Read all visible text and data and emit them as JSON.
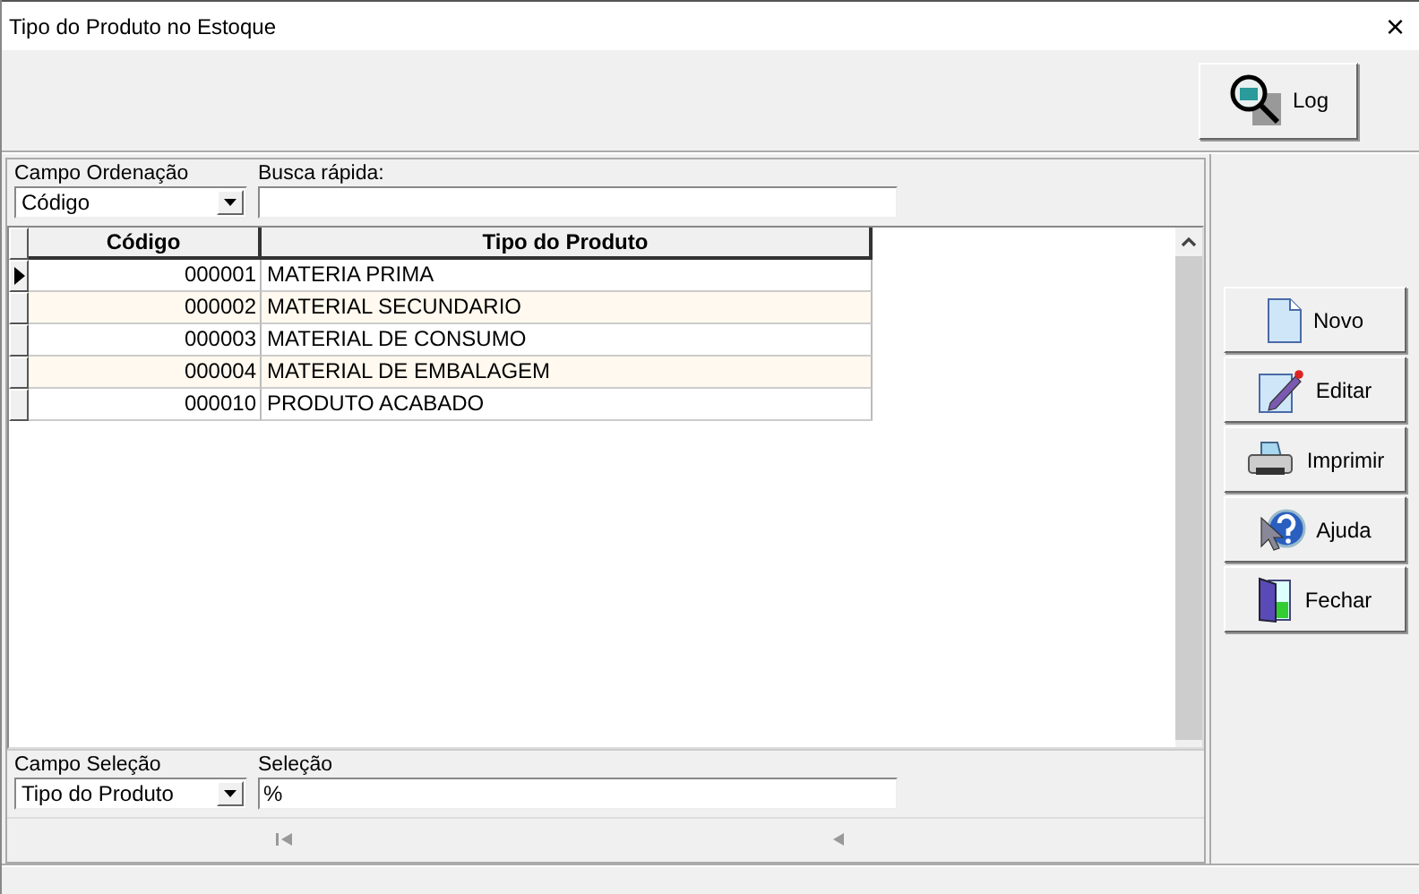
{
  "window": {
    "title": "Tipo do Produto no Estoque",
    "close": "×"
  },
  "toolbar": {
    "log_button": "Log"
  },
  "filters": {
    "sort_field": {
      "label": "Campo Ordenação",
      "value": "Código"
    },
    "quick_search": {
      "label": "Busca rápida:"
    }
  },
  "table": {
    "columns": [
      "Código",
      "Tipo do Produto"
    ],
    "rows": [
      {
        "codigo": "000001",
        "tipo": "MATERIA PRIMA",
        "selected": true
      },
      {
        "codigo": "000002",
        "tipo": "MATERIAL SECUNDARIO",
        "selected": false
      },
      {
        "codigo": "000003",
        "tipo": "MATERIAL DE CONSUMO",
        "selected": false
      },
      {
        "codigo": "000004",
        "tipo": "MATERIAL DE EMBALAGEM",
        "selected": false
      },
      {
        "codigo": "000010",
        "tipo": "PRODUTO ACABADO",
        "selected": false
      }
    ]
  },
  "selection": {
    "field": {
      "label": "Campo Seleção",
      "value": "Tipo do Produto"
    },
    "value": {
      "label": "Seleção",
      "value": "%"
    }
  },
  "actions": [
    {
      "kind": "new",
      "label": "Novo"
    },
    {
      "kind": "edit",
      "label": "Editar"
    },
    {
      "kind": "print",
      "label": "Imprimir"
    },
    {
      "kind": "help",
      "label": "Ajuda"
    },
    {
      "kind": "close",
      "label": "Fechar"
    }
  ]
}
